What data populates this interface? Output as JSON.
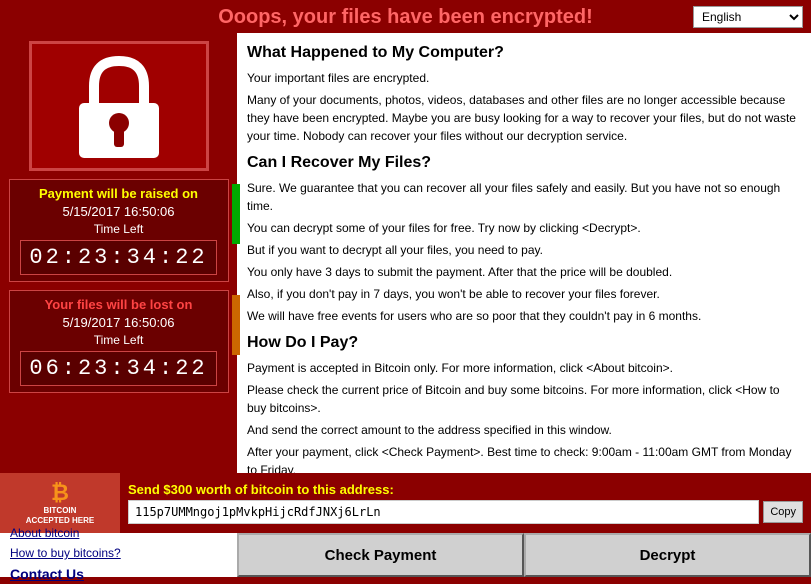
{
  "header": {
    "title": "Ooops, your files have been encrypted!",
    "lang_selected": "English"
  },
  "left": {
    "payment_box1": {
      "title": "Payment will be raised on",
      "date": "5/15/2017 16:50:06",
      "time_left_label": "Time Left",
      "timer": "02:23:34:22"
    },
    "payment_box2": {
      "title": "Your files will be lost on",
      "date": "5/19/2017 16:50:06",
      "time_left_label": "Time Left",
      "timer": "06:23:34:22"
    }
  },
  "content": {
    "section1_title": "What Happened to My Computer?",
    "section1_p1": "Your important files are encrypted.",
    "section1_p2": "Many of your documents, photos, videos, databases and other files are no longer accessible because they have been encrypted. Maybe you are busy looking for a way to recover your files, but do not waste your time. Nobody can recover your files without our decryption service.",
    "section2_title": "Can I Recover My Files?",
    "section2_p1": "Sure. We guarantee that you can recover all your files safely and easily. But you have not so enough time.",
    "section2_p2": "You can decrypt some of your files for free. Try now by clicking <Decrypt>.",
    "section2_p3": "But if you want to decrypt all your files, you need to pay.",
    "section2_p4": "You only have 3 days to submit the payment. After that the price will be doubled.",
    "section2_p5": "Also, if you don't pay in 7 days, you won't be able to recover your files forever.",
    "section2_p6": "We will have free events for users who are so poor that they couldn't pay in 6 months.",
    "section3_title": "How Do I Pay?",
    "section3_p1": "Payment is accepted in Bitcoin only. For more information, click <About bitcoin>.",
    "section3_p2": "Please check the current price of Bitcoin and buy some bitcoins. For more information, click <How to buy bitcoins>.",
    "section3_p3": "And send the correct amount to the address specified in this window.",
    "section3_p4": "After your payment, click <Check Payment>. Best time to check: 9:00am - 11:00am GMT from Monday to Friday."
  },
  "bitcoin": {
    "logo": "₿",
    "accepted_text": "bitcoin\nACCEPTED HERE",
    "send_label": "Send $300 worth of bitcoin to this address:",
    "address": "115p7UMMngoj1pMvkpHijcRdfJNXj6LrLn",
    "copy_label": "Copy"
  },
  "bottom": {
    "about_bitcoin": "About bitcoin",
    "how_to_buy": "How to buy bitcoins?",
    "contact_us": "Contact Us",
    "check_payment": "Check Payment",
    "decrypt": "Decrypt"
  }
}
